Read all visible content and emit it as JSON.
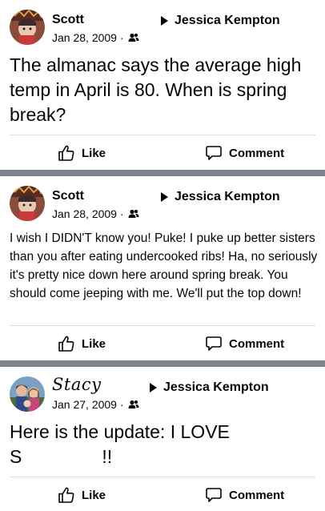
{
  "posts": [
    {
      "author": "Scott",
      "date": "Jan 28, 2009 ·",
      "audience_icon": "friends-icon",
      "target": "Jessica Kempton",
      "text": "The almanac says the average high temp in April is 80. When is spring break?",
      "like_label": "Like",
      "comment_label": "Comment"
    },
    {
      "author": "Scott",
      "date": "Jan 28, 2009 ·",
      "audience_icon": "friends-icon",
      "target": "Jessica Kempton",
      "text": "I wish I DIDN'T know you! Puke! I puke up better sisters than you after eating undercooked ribs! Ha, no seriously it's pretty nice down here around spring break. You should come jeeping with me. We'll put the top down!",
      "like_label": "Like",
      "comment_label": "Comment"
    },
    {
      "author": "Stacy",
      "date": "Jan 27, 2009 ·",
      "audience_icon": "friends-icon",
      "target": "Jessica Kempton",
      "text_line1": "Here is the update:  I LOVE",
      "text_line2_start": "S",
      "text_line2_end": "!!",
      "like_label": "Like",
      "comment_label": "Comment"
    }
  ],
  "colors": {
    "divider": "#7d848c",
    "separator": "#dadde1",
    "text": "#050505"
  }
}
